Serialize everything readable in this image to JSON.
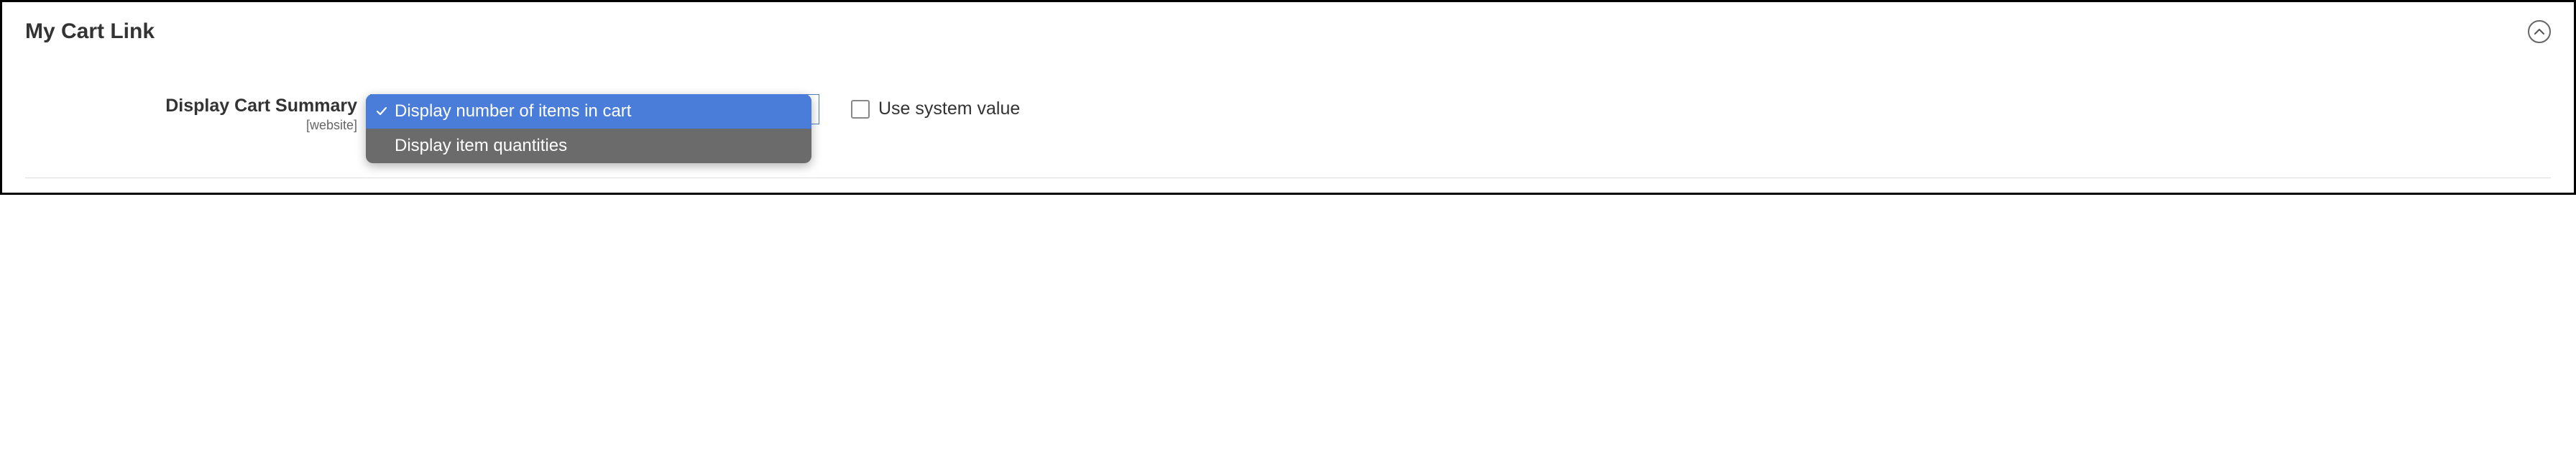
{
  "section": {
    "title": "My Cart Link"
  },
  "field": {
    "label": "Display Cart Summary",
    "scope": "[website]",
    "options": [
      {
        "label": "Display number of items in cart",
        "selected": true
      },
      {
        "label": "Display item quantities",
        "selected": false
      }
    ]
  },
  "system_value": {
    "label": "Use system value",
    "checked": false
  }
}
